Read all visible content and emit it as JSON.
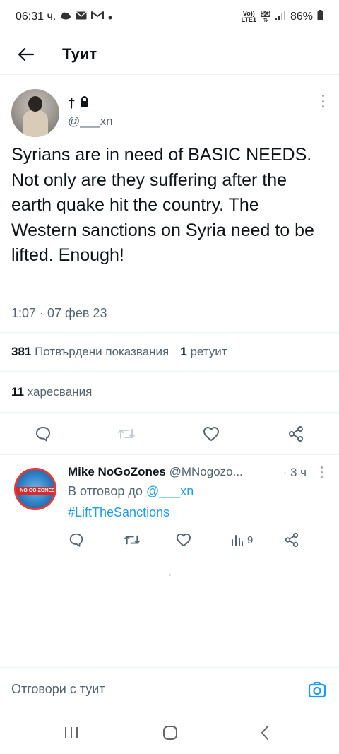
{
  "status_bar": {
    "time": "06:31 ч.",
    "network_top": "Vo))",
    "network_bottom": "LTE1",
    "network_5g": "5G",
    "battery": "86%"
  },
  "header": {
    "title": "Туит"
  },
  "tweet": {
    "author_name": "†",
    "handle": "@___xn",
    "text": "Syrians are in need of BASIC NEEDS. Not only are they suffering after the earth quake hit the country. The Western sanctions on Syria need to be lifted. Enough!",
    "time": "1:07 · 07 фев 23",
    "views_count": "381",
    "views_label": "Потвърдени показвания",
    "retweets_count": "1",
    "retweets_label": "ретуит",
    "likes_count": "11",
    "likes_label": "харесвания"
  },
  "reply": {
    "name": "Mike NoGoZones",
    "handle": "@MNogozo...",
    "time": "· 3 ч",
    "replying_prefix": "В отговор до",
    "replying_to": "@___xn",
    "hashtag": "#LiftTheSanctions",
    "views": "9",
    "avatar_text": "NO GO ZONES"
  },
  "reply_bar": {
    "placeholder": "Отговори с туит"
  },
  "colors": {
    "accent": "#1d9bf0",
    "text": "#0f1419",
    "secondary": "#536471",
    "border": "#eff3f4"
  }
}
